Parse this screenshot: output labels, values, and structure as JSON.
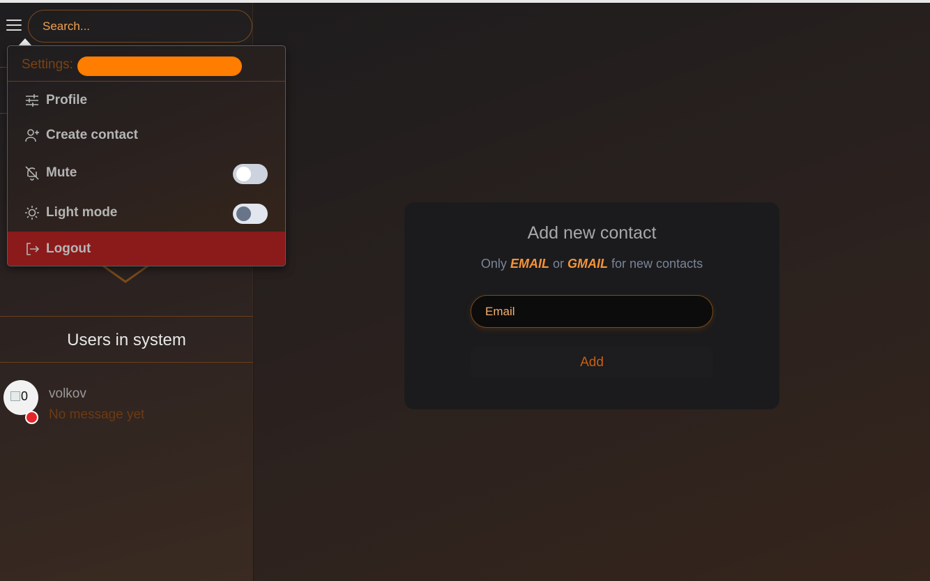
{
  "sidebar": {
    "search_placeholder": "Search...",
    "users_title": "Users in system",
    "users": [
      {
        "name": "volkov",
        "last_message": "No message yet",
        "avatar_alt": "0",
        "status_color": "#e5252a"
      }
    ]
  },
  "dropdown": {
    "header": "Settings:",
    "items": [
      {
        "label": "Profile",
        "icon": "sliders-icon"
      },
      {
        "label": "Create contact",
        "icon": "user-plus-icon"
      },
      {
        "label": "Mute",
        "icon": "bell-off-icon",
        "toggle_on": false
      },
      {
        "label": "Light mode",
        "icon": "sun-icon",
        "toggle_on": false
      },
      {
        "label": "Logout",
        "icon": "logout-icon"
      }
    ]
  },
  "card": {
    "title": "Add new contact",
    "subtitle_prefix": "Only",
    "subtitle_em1": "EMAIL",
    "subtitle_mid": "or",
    "subtitle_em2": "GMAIL",
    "subtitle_suffix": "for new contacts",
    "email_placeholder": "Email",
    "add_label": "Add"
  },
  "colors": {
    "accent": "#f5943a",
    "border_accent": "#7a4a1a",
    "logout_bg": "#8b1a1b",
    "redaction": "#ff7d00"
  }
}
